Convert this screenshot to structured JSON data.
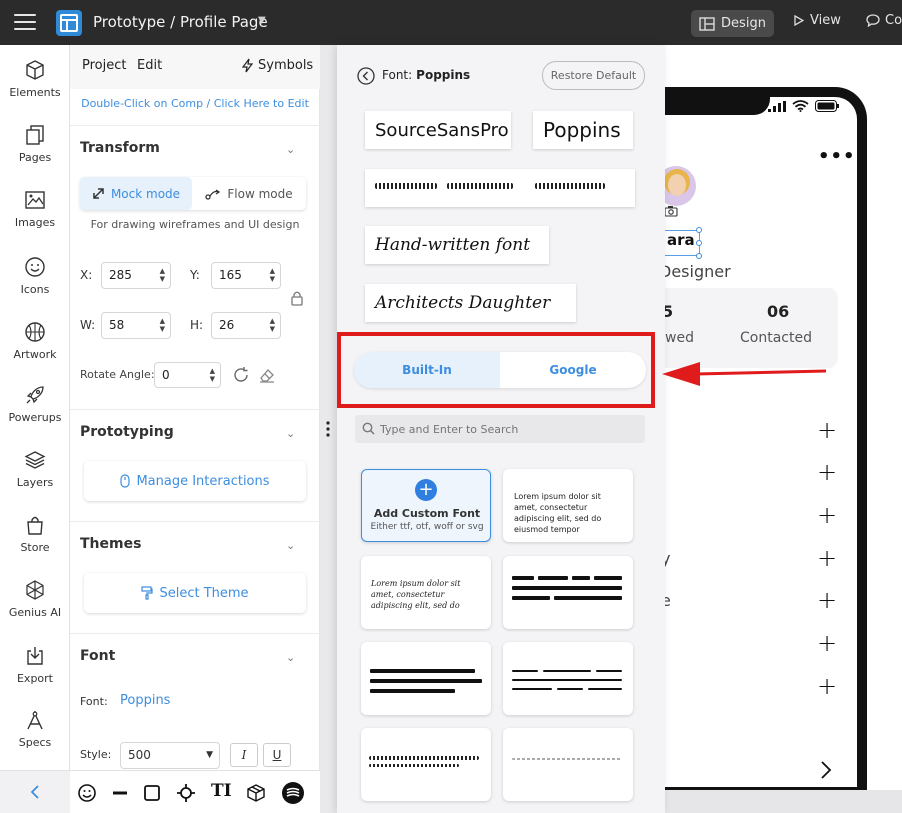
{
  "topbar": {
    "title": "Prototype / Profile Page",
    "design_label": "Design",
    "view_label": "View",
    "comment_label": "Co"
  },
  "rail": {
    "items": [
      {
        "label": "Elements",
        "icon": "cube-icon"
      },
      {
        "label": "Pages",
        "icon": "pages-icon"
      },
      {
        "label": "Images",
        "icon": "image-icon"
      },
      {
        "label": "Icons",
        "icon": "smiley-icon"
      },
      {
        "label": "Artwork",
        "icon": "basketball-icon"
      },
      {
        "label": "Powerups",
        "icon": "rocket-icon"
      },
      {
        "label": "Layers",
        "icon": "layers-icon"
      },
      {
        "label": "Store",
        "icon": "bag-icon"
      },
      {
        "label": "Genius AI",
        "icon": "ai-icon"
      },
      {
        "label": "Export",
        "icon": "export-icon"
      },
      {
        "label": "Specs",
        "icon": "compass-icon"
      }
    ]
  },
  "panel": {
    "tabs": {
      "project": "Project",
      "edit": "Edit",
      "symbols": "Symbols"
    },
    "hint": "Double-Click on Comp / Click Here to Edit",
    "transform": {
      "title": "Transform",
      "mock_mode": "Mock mode",
      "flow_mode": "Flow mode",
      "mode_hint": "For drawing wireframes and UI design",
      "x_label": "X:",
      "x_value": "285",
      "y_label": "Y:",
      "y_value": "165",
      "w_label": "W:",
      "w_value": "58",
      "h_label": "H:",
      "h_value": "26",
      "rotate_label": "Rotate Angle:",
      "rotate_value": "0"
    },
    "prototyping": {
      "title": "Prototyping",
      "button": "Manage Interactions"
    },
    "themes": {
      "title": "Themes",
      "button": "Select Theme"
    },
    "font": {
      "title": "Font",
      "font_label": "Font:",
      "font_value": "Poppins",
      "style_label": "Style:",
      "style_value": "500",
      "italic": "I",
      "underline": "U"
    },
    "toolbar_glyph": "TI"
  },
  "popover": {
    "title_prefix": "Font:",
    "title_font": "Poppins",
    "restore_label": "Restore Default",
    "samples": [
      "SourceSansPro",
      "Poppins",
      "Hand-written font",
      "Architects Daughter"
    ],
    "tabs": {
      "builtin": "Built-In",
      "google": "Google"
    },
    "search_placeholder": "Type and Enter to Search",
    "add_card": {
      "title": "Add Custom Font",
      "subtitle": "Either ttf, otf, woff or svg"
    },
    "lorem1": "Lorem ipsum dolor sit amet, consectetur adipiscing elit, sed do eiusmod tempor",
    "lorem2": "Lorem ipsum dolor sit amet, consectetur adipiscing elit, sed do",
    "accent": "#3d8ee0",
    "highlight": "#e01b1b"
  },
  "canvas": {
    "name": "ara",
    "role": "Designer",
    "stat1_num": "5",
    "stat1_label": "wed",
    "stat2_num": "06",
    "stat2_label": "Contacted",
    "frag1": "y",
    "frag2": "e"
  }
}
